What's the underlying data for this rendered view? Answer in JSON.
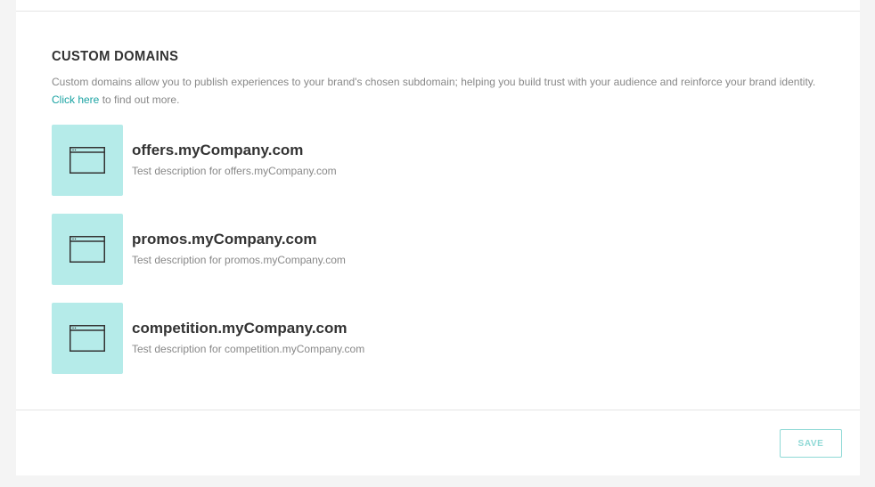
{
  "section": {
    "title": "CUSTOM DOMAINS",
    "description": "Custom domains allow you to publish experiences to your brand's chosen subdomain; helping you build trust with your audience and reinforce your brand identity.",
    "link_text": "Click here",
    "link_suffix": " to find out more."
  },
  "domains": [
    {
      "name": "offers.myCompany.com",
      "description": "Test description for offers.myCompany.com",
      "icon": "browser-window-icon"
    },
    {
      "name": "promos.myCompany.com",
      "description": "Test description for promos.myCompany.com",
      "icon": "browser-window-icon"
    },
    {
      "name": "competition.myCompany.com",
      "description": "Test description for competition.myCompany.com",
      "icon": "browser-window-icon"
    }
  ],
  "footer": {
    "save_label": "SAVE"
  },
  "colors": {
    "accent": "#1aa3a3",
    "thumb_background": "#b5ebe9",
    "save_button": "#8fd9d6",
    "page_background": "#f4f4f4"
  }
}
